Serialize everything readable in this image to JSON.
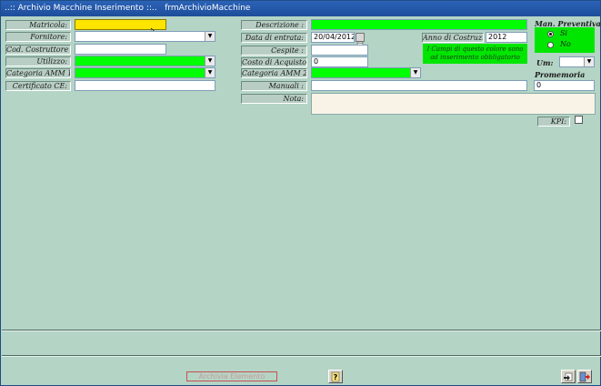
{
  "window": {
    "title": "..:: Archivio Macchine Inserimento ::..   frmArchivioMacchine"
  },
  "left": {
    "matricola_label": "Matricola:",
    "fornitore_label": "Fornitore:",
    "cod_costruttore_label": "Cod. Costruttore",
    "utilizzo_label": "Utilizzo:",
    "categoria1_label": "Categoria AMM 1:",
    "certificato_label": "Certificato CE:"
  },
  "middle": {
    "descrizione_label": "Descrizione :",
    "data_entrata_label": "Data di entrata:",
    "data_entrata_value": "20/04/2012",
    "cespite_label": "Cespite :",
    "costo_label": "Costo di Acquisto € :",
    "costo_value": "0",
    "categoria2_label": "Categoria AMM 2:",
    "manuali_label": "Manuali :",
    "nota_label": "Nota:",
    "anno_label": "Anno di Costruzione:",
    "anno_value": "2012",
    "required_hint": "I Campi di questo colore sono ad inserimento obbligatorio"
  },
  "right": {
    "man_preventiva_label": "Man. Preventiva",
    "radio_si": "Si",
    "radio_no": "No",
    "um_label": "Um:",
    "promemoria_label": "Promemoria",
    "promemoria_value": "0",
    "kpi_label": "KPI:"
  },
  "footer": {
    "disabled_button_label": "Archivia Elemento"
  },
  "colors": {
    "required": "#00ff00",
    "focused": "#ffe400",
    "background": "#b4d4c5"
  },
  "icons": {
    "help": "help-icon",
    "save": "save-icon",
    "exit": "exit-icon",
    "calendar": "calendar-icon"
  }
}
